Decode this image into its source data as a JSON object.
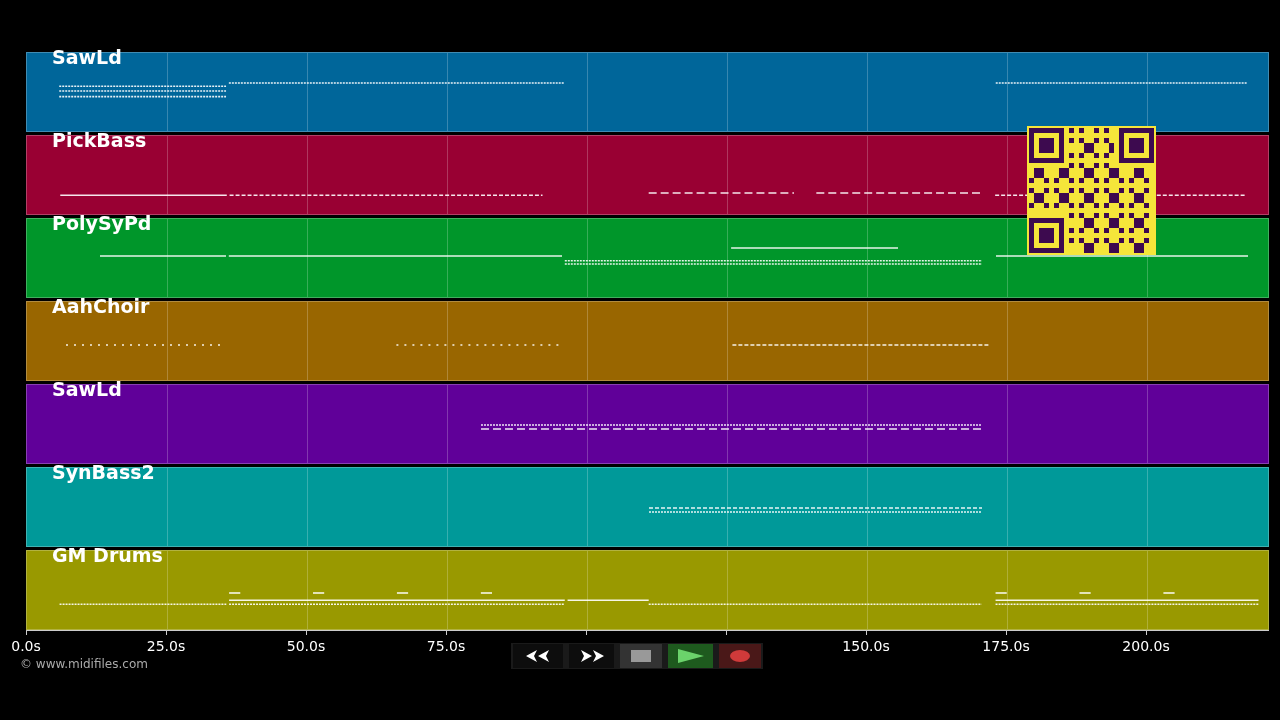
{
  "tracks": [
    {
      "name": "SawLd",
      "color": "#00669a"
    },
    {
      "name": "PickBass",
      "color": "#990033"
    },
    {
      "name": "PolySyPd",
      "color": "#00962a"
    },
    {
      "name": "AahChoir",
      "color": "#996600"
    },
    {
      "name": "SawLd",
      "color": "#600099"
    },
    {
      "name": "SynBass2",
      "color": "#009999"
    },
    {
      "name": "GM Drums",
      "color": "#999900"
    }
  ],
  "axis": {
    "ticks": [
      "0.0s",
      "25.0s",
      "50.0s",
      "75.0s",
      "150.0s",
      "175.0s",
      "200.0s"
    ]
  },
  "credit": "© www.midifiles.com"
}
